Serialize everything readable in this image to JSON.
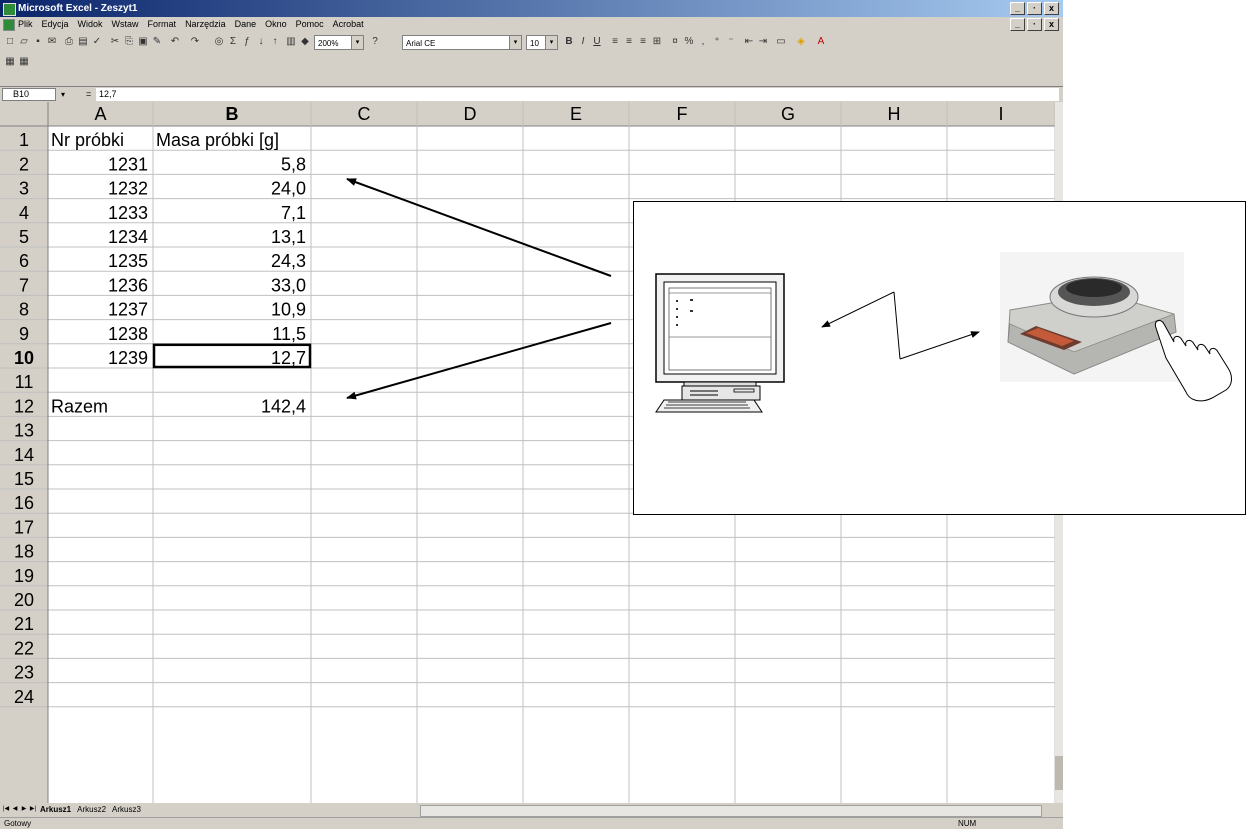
{
  "window": {
    "title": "Microsoft Excel - Zeszyt1",
    "controls": [
      "_",
      "·",
      "x"
    ]
  },
  "menubar": {
    "items": [
      "Plik",
      "Edycja",
      "Widok",
      "Wstaw",
      "Format",
      "Narzędzia",
      "Dane",
      "Okno",
      "Pomoc",
      "Acrobat"
    ]
  },
  "toolbar": {
    "zoom": "200%",
    "font_name": "Arial CE",
    "font_size": "10"
  },
  "formula_bar": {
    "name_box": "B10",
    "equals": "=",
    "value": "12,7"
  },
  "grid": {
    "columns": [
      "A",
      "B",
      "C",
      "D",
      "E",
      "F",
      "G",
      "H",
      "I"
    ],
    "rows": [
      "1",
      "2",
      "3",
      "4",
      "5",
      "6",
      "7",
      "8",
      "9",
      "10",
      "11",
      "12",
      "13",
      "14",
      "15",
      "16",
      "17",
      "18",
      "19",
      "20",
      "21",
      "22",
      "23",
      "24"
    ],
    "active_row": "10",
    "cells": {
      "A1": "Nr próbki",
      "B1": "Masa próbki [g]",
      "A2": "1231",
      "B2": "5,8",
      "A3": "1232",
      "B3": "24,0",
      "A4": "1233",
      "B4": "7,1",
      "A5": "1234",
      "B5": "13,1",
      "A6": "1235",
      "B6": "24,3",
      "A7": "1236",
      "B7": "33,0",
      "A8": "1237",
      "B8": "10,9",
      "A9": "1238",
      "B9": "11,5",
      "A10": "1239",
      "B10": "12,7",
      "A12": "Razem",
      "B12": "142,4"
    }
  },
  "sheet_tabs": [
    "Arkusz1",
    "Arkusz2",
    "Arkusz3"
  ],
  "status": {
    "left": "Gotowy",
    "right": "NUM"
  },
  "colors": {
    "title_start": "#0a246a",
    "title_end": "#a6caf0",
    "chrome": "#d4d0c8",
    "gridline": "#c0c0c0"
  },
  "icons": {
    "computer": "computer-icon",
    "scale": "scale-icon",
    "hand": "hand-pointer-icon"
  }
}
